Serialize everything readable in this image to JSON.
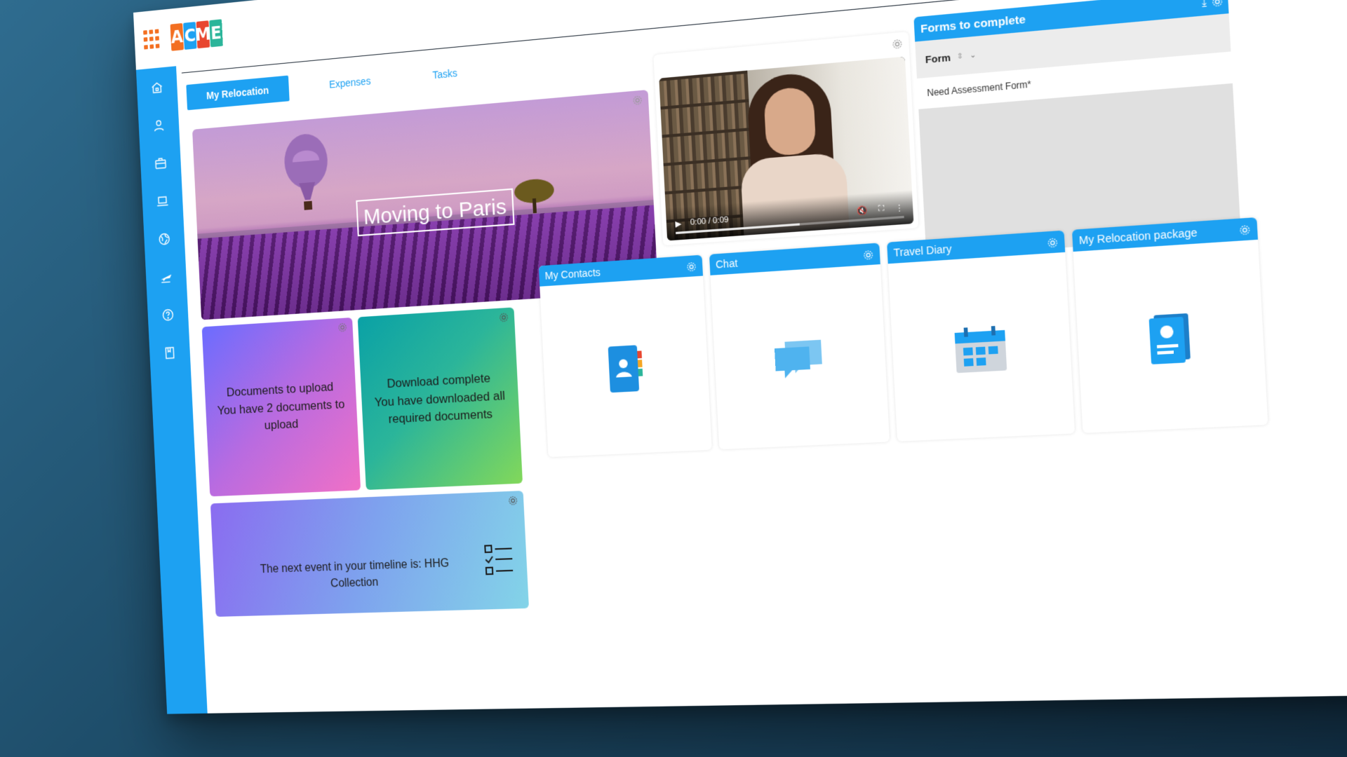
{
  "app": {
    "logo_letters": [
      {
        "char": "A",
        "color": "#f36f21"
      },
      {
        "char": "C",
        "color": "#1da1f2"
      },
      {
        "char": "M",
        "color": "#e8462f"
      },
      {
        "char": "E",
        "color": "#2bb59a"
      }
    ],
    "accent_color": "#1da1f2"
  },
  "sidebar": {
    "items": [
      {
        "icon": "home-icon"
      },
      {
        "icon": "user-icon"
      },
      {
        "icon": "briefcase-icon"
      },
      {
        "icon": "laptop-icon"
      },
      {
        "icon": "globe-icon"
      },
      {
        "icon": "airplane-icon"
      },
      {
        "icon": "help-icon"
      },
      {
        "icon": "book-icon"
      }
    ]
  },
  "tabs": [
    {
      "label": "My Relocation",
      "active": true
    },
    {
      "label": "Expenses",
      "active": false
    },
    {
      "label": "Tasks",
      "active": false
    }
  ],
  "hero": {
    "title": "Moving to Paris"
  },
  "video": {
    "time": "0:00 / 0:09",
    "progress": 0.55
  },
  "forms": {
    "title": "Forms to complete",
    "column": "Form",
    "rows": [
      "Need Assessment Form*"
    ]
  },
  "tiles": {
    "documents": {
      "title": "Documents to upload",
      "body": "You have 2 documents to upload"
    },
    "download": {
      "title": "Download complete",
      "body": "You have downloaded all required documents"
    },
    "contacts": {
      "title": "My Contacts"
    },
    "chat": {
      "title": "Chat"
    },
    "diary": {
      "title": "Travel Diary"
    },
    "package": {
      "title": "My Relocation package"
    },
    "timeline": {
      "text": "The next event in your timeline is: HHG Collection"
    }
  }
}
